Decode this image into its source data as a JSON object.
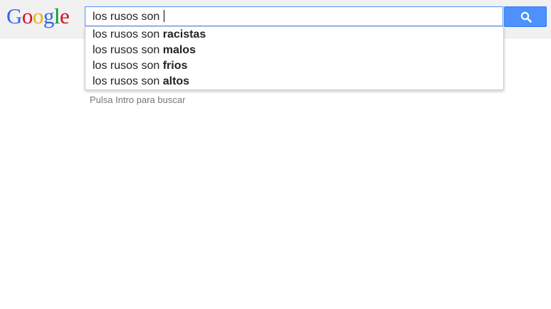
{
  "logo": {
    "letters": [
      {
        "char": "G",
        "color": "#3369e8"
      },
      {
        "char": "o",
        "color": "#d50f25"
      },
      {
        "char": "o",
        "color": "#eeb211"
      },
      {
        "char": "g",
        "color": "#3369e8"
      },
      {
        "char": "l",
        "color": "#009925"
      },
      {
        "char": "e",
        "color": "#d50f25"
      }
    ]
  },
  "search": {
    "value": "los rusos son ",
    "button_icon": "search-icon"
  },
  "suggestions": [
    {
      "prefix": "los rusos son ",
      "completion": "racistas"
    },
    {
      "prefix": "los rusos son ",
      "completion": "malos"
    },
    {
      "prefix": "los rusos son ",
      "completion": "frios"
    },
    {
      "prefix": "los rusos son ",
      "completion": "altos"
    }
  ],
  "hint": "Pulsa Intro para buscar",
  "colors": {
    "accent": "#4d90fe",
    "header_bg": "#f1f1f1"
  }
}
